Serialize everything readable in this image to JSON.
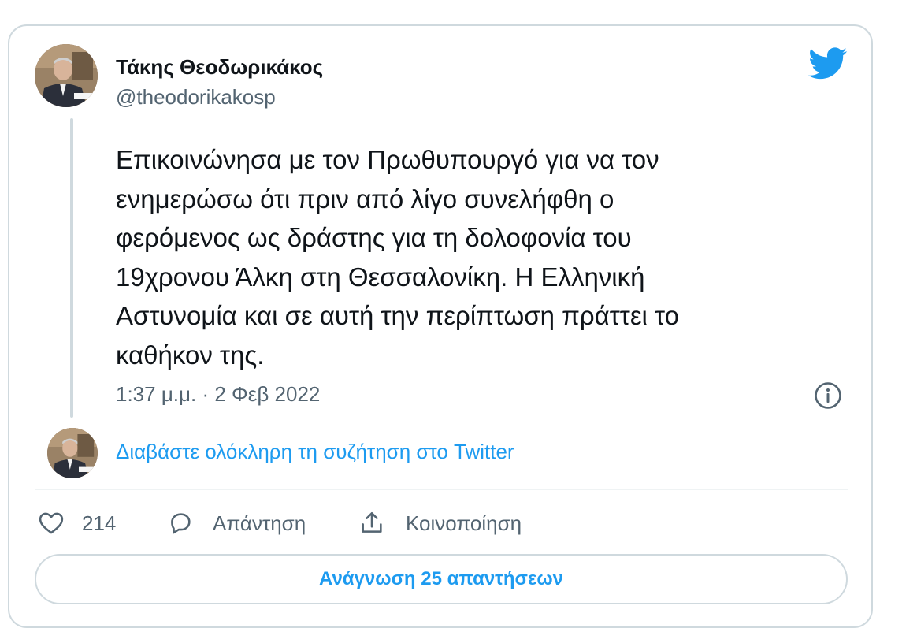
{
  "author": {
    "name": "Τάκης Θεοδωρικάκος",
    "handle": "@theodorikakosp"
  },
  "tweet": {
    "text": "Επικοινώνησα με τον Πρωθυπουργό  για να τον\nενημερώσω ότι πριν από λίγο συνελήφθη ο\nφερόμενος ως δράστης για τη δολοφονία του\n19χρονου Άλκη στη Θεσσαλονίκη. Η Ελληνική\nΑστυνομία και σε αυτή την περίπτωση πράττει το\nκαθήκον της.",
    "timestamp": "1:37 μ.μ. · 2 Φεβ 2022"
  },
  "conversation": {
    "link_label": "Διαβάστε ολόκληρη τη συζήτηση στο Twitter"
  },
  "actions": {
    "like_count": "214",
    "reply_label": "Απάντηση",
    "share_label": "Κοινοποίηση"
  },
  "replies_button": {
    "label": "Ανάγνωση 25 απαντήσεων"
  },
  "icons": {
    "brand": "twitter-bird-icon",
    "info": "info-icon",
    "like": "heart-icon",
    "reply": "speech-bubble-icon",
    "share": "share-upload-icon"
  },
  "colors": {
    "accent": "#1d9bf0",
    "text_primary": "#0f1419",
    "text_secondary": "#536471",
    "border": "#cfd9de"
  }
}
